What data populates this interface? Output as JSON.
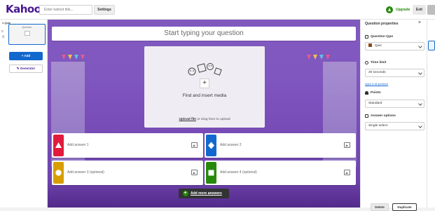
{
  "app": {
    "logo": "Kahoot!"
  },
  "header": {
    "title_placeholder": "Enter kahoot title...",
    "settings_label": "Settings",
    "upgrade_label": "Upgrade",
    "exit_label": "Exit"
  },
  "sidebar": {
    "quiz_label": "1 Quiz",
    "thumb_title": "Question",
    "add_label": "+ Add",
    "generator_label": "Generator"
  },
  "editor": {
    "question_placeholder": "Start typing your question",
    "media_label": "Find and insert media",
    "upload_link": "Upload file",
    "upload_suffix": " or drag here to upload",
    "answers": [
      {
        "text": "Add answer 1",
        "color": "#e21b3c",
        "shape": "triangle"
      },
      {
        "text": "Add answer 2",
        "color": "#1368ce",
        "shape": "diamond"
      },
      {
        "text": "Add answer 3 (optional)",
        "color": "#d89e00",
        "shape": "circle"
      },
      {
        "text": "Add answer 4 (optional)",
        "color": "#26890c",
        "shape": "square"
      }
    ],
    "add_more_label": "Add more answers"
  },
  "properties": {
    "title": "Question properties",
    "question_type_label": "Question type",
    "question_type_value": "Quiz",
    "time_limit_label": "Time limit",
    "time_limit_value": "20 seconds",
    "apply_all": "Apply to all questions",
    "points_label": "Points",
    "points_value": "Standard",
    "answer_options_label": "Answer options",
    "answer_options_value": "Single select",
    "delete_label": "Delete",
    "duplicate_label": "Duplicate"
  },
  "colors": {
    "brand": "#46178f",
    "primary": "#1368ce",
    "success": "#26890c"
  }
}
